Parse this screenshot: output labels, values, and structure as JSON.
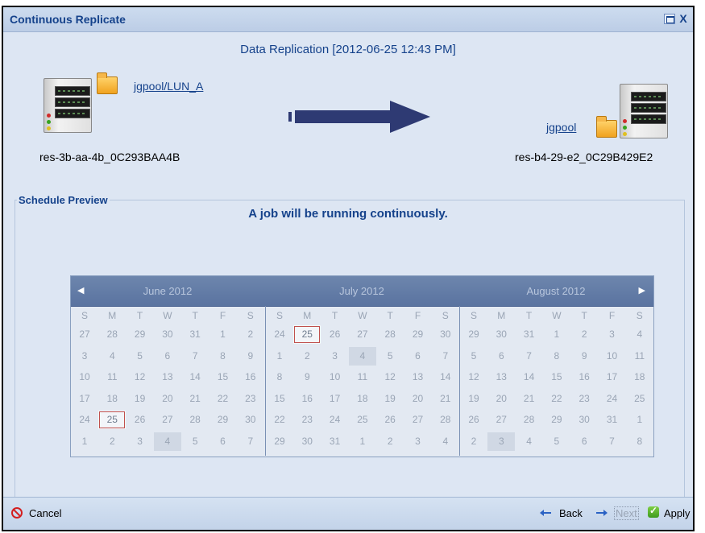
{
  "window": {
    "title": "Continuous Replicate",
    "close_glyph": "X",
    "heading": "Data Replication [2012-06-25 12:43 PM]"
  },
  "source": {
    "volume_link": "jgpool/LUN_A",
    "host": "res-3b-aa-4b_0C293BAA4B",
    "icon": "server-icon"
  },
  "target": {
    "volume_link": "jgpool",
    "host": "res-b4-29-e2_0C29B429E2",
    "icon": "server-icon"
  },
  "schedule": {
    "legend": "Schedule Preview",
    "message": "A job will be running continuously."
  },
  "calendar": {
    "prev_glyph": "◀",
    "next_glyph": "▶",
    "weekdays": [
      "S",
      "M",
      "T",
      "W",
      "T",
      "F",
      "S"
    ],
    "months": [
      {
        "title": "June 2012",
        "days": [
          [
            "27",
            "28",
            "29",
            "30",
            "31",
            "1",
            "2"
          ],
          [
            "3",
            "4",
            "5",
            "6",
            "7",
            "8",
            "9"
          ],
          [
            "10",
            "11",
            "12",
            "13",
            "14",
            "15",
            "16"
          ],
          [
            "17",
            "18",
            "19",
            "20",
            "21",
            "22",
            "23"
          ],
          [
            "24",
            "25",
            "26",
            "27",
            "28",
            "29",
            "30"
          ],
          [
            "1",
            "2",
            "3",
            "4",
            "5",
            "6",
            "7"
          ]
        ],
        "today": [
          4,
          1
        ],
        "shaded": [
          [
            5,
            3
          ]
        ]
      },
      {
        "title": "July 2012",
        "days": [
          [
            "24",
            "25",
            "26",
            "27",
            "28",
            "29",
            "30"
          ],
          [
            "1",
            "2",
            "3",
            "4",
            "5",
            "6",
            "7"
          ],
          [
            "8",
            "9",
            "10",
            "11",
            "12",
            "13",
            "14"
          ],
          [
            "15",
            "16",
            "17",
            "18",
            "19",
            "20",
            "21"
          ],
          [
            "22",
            "23",
            "24",
            "25",
            "26",
            "27",
            "28"
          ],
          [
            "29",
            "30",
            "31",
            "1",
            "2",
            "3",
            "4"
          ]
        ],
        "today": [
          0,
          1
        ],
        "shaded": [
          [
            1,
            3
          ]
        ]
      },
      {
        "title": "August 2012",
        "days": [
          [
            "29",
            "30",
            "31",
            "1",
            "2",
            "3",
            "4"
          ],
          [
            "5",
            "6",
            "7",
            "8",
            "9",
            "10",
            "11"
          ],
          [
            "12",
            "13",
            "14",
            "15",
            "16",
            "17",
            "18"
          ],
          [
            "19",
            "20",
            "21",
            "22",
            "23",
            "24",
            "25"
          ],
          [
            "26",
            "27",
            "28",
            "29",
            "30",
            "31",
            "1"
          ],
          [
            "2",
            "3",
            "4",
            "5",
            "6",
            "7",
            "8"
          ]
        ],
        "today": null,
        "shaded": [
          [
            5,
            1
          ]
        ]
      }
    ]
  },
  "footer": {
    "cancel_label": "Cancel",
    "back_label": "Back",
    "next_label": "Next",
    "apply_label": "Apply"
  },
  "colors": {
    "accent": "#15428b",
    "arrow": "#2e3a73",
    "cancel": "#d32020",
    "apply": "#4caf28"
  }
}
